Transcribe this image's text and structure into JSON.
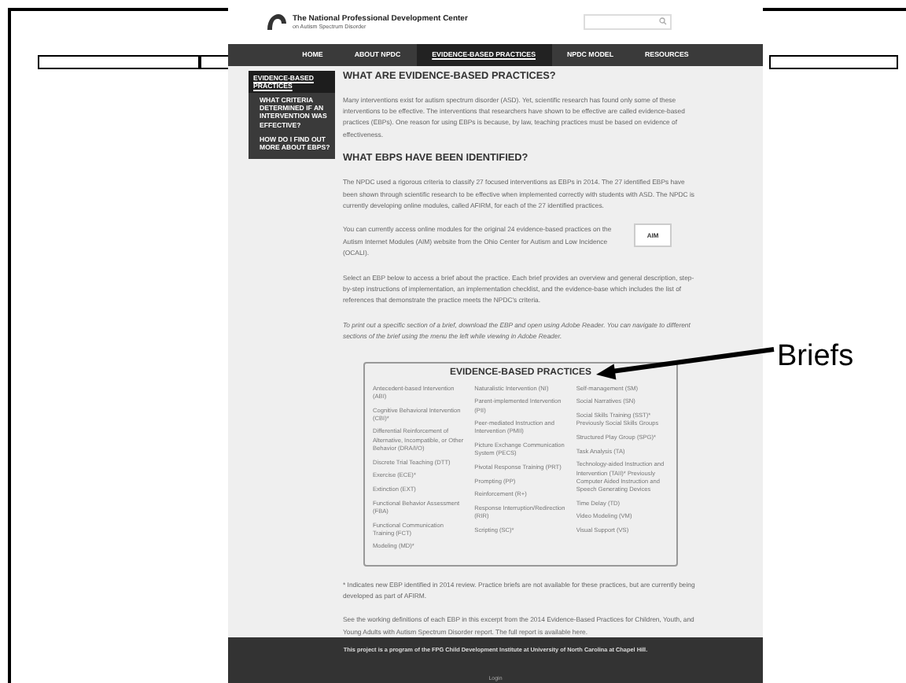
{
  "annotation": {
    "label": "Briefs"
  },
  "site": {
    "title": "The National Professional Development Center",
    "subtitle": "on Autism Spectrum Disorder"
  },
  "nav": [
    {
      "label": "HOME",
      "selected": false
    },
    {
      "label": "ABOUT NPDC",
      "selected": false
    },
    {
      "label": "EVIDENCE-BASED PRACTICES",
      "selected": true
    },
    {
      "label": "NPDC MODEL",
      "selected": false
    },
    {
      "label": "RESOURCES",
      "selected": false
    }
  ],
  "sidebar": [
    {
      "label": "EVIDENCE-BASED PRACTICES",
      "selected": true
    },
    {
      "label": "WHAT CRITERIA DETERMINED IF AN INTERVENTION WAS EFFECTIVE?",
      "selected": false
    },
    {
      "label": "HOW DO I FIND OUT MORE ABOUT EBPS?",
      "selected": false
    }
  ],
  "content": [
    {
      "kind": "heading",
      "text": "WHAT ARE EVIDENCE-BASED PRACTICES?"
    },
    {
      "kind": "para",
      "text": "Many interventions exist for autism spectrum disorder (ASD). Yet, scientific research has found only some of these interventions to be effective. The interventions that researchers have shown to be effective are called evidence-based practices (EBPs). One reason for using EBPs is because, by law, teaching practices must be based on evidence of effectiveness."
    },
    {
      "kind": "heading",
      "text": "WHAT EBPS HAVE BEEN IDENTIFIED?"
    },
    {
      "kind": "para",
      "text": "The NPDC used a rigorous criteria to classify 27 focused interventions as EBPs in 2014. The 27 identified EBPs have been shown through scientific research to be effective when implemented correctly with students with ASD. The NPDC is currently developing online modules, called AFIRM, for each of the 27 identified practices."
    },
    {
      "kind": "logo-para",
      "text": "You can currently access online modules for the original 24 evidence-based practices on the Autism Internet Modules (AIM) website from the Ohio Center for Autism and Low Incidence (OCALI).",
      "logo": "AIM"
    },
    {
      "kind": "para",
      "text": "Select an EBP below to access a brief about the practice. Each brief provides an overview and general description, step-by-step instructions of implementation, an implementation checklist, and the evidence-base which includes the list of references that demonstrate the practice meets the NPDC's criteria."
    },
    {
      "kind": "italic",
      "text": "To print out a specific section of a brief, download the EBP and open using Adobe Reader. You can navigate to different sections of the brief using the menu the left while viewing in Adobe Reader."
    }
  ],
  "practices": {
    "title": "EVIDENCE-BASED PRACTICES",
    "columns": [
      [
        "Antecedent-based Intervention (ABI)",
        "Cognitive Behavioral Intervention (CBI)*",
        "Differential Reinforcement of Alternative, Incompatible, or Other Behavior (DRA/I/O)",
        "Discrete Trial Teaching (DTT)",
        "Exercise (ECE)*",
        "Extinction (EXT)",
        "Functional Behavior Assessment (FBA)",
        "Functional Communication Training (FCT)",
        "Modeling (MD)*"
      ],
      [
        "Naturalistic Intervention (NI)",
        "Parent-implemented Intervention (PII)",
        "Peer-mediated Instruction and Intervention (PMII)",
        "Picture Exchange Communication System (PECS)",
        "Pivotal Response Training (PRT)",
        "Prompting (PP)",
        "Reinforcement (R+)",
        "Response Interruption/Redirection (RIR)",
        "Scripting (SC)*"
      ],
      [
        "Self-management (SM)",
        "Social Narratives (SN)",
        "Social Skills Training (SST)* Previously Social Skills Groups",
        "Structured Play Group (SPG)*",
        "Task Analysis (TA)",
        "Technology-aided Instruction and Intervention (TAII)* Previously Computer Aided Instruction and Speech Generating Devices",
        "Time Delay (TD)",
        "Video Modeling (VM)",
        "Visual Support (VS)"
      ]
    ]
  },
  "notes": [
    "* Indicates new EBP identified in 2014 review. Practice briefs are not available for these practices, but are currently being developed as part of AFIRM.",
    "See the working definitions of each EBP in this excerpt from the 2014 Evidence-Based Practices for Children, Youth, and Young Adults with Autism Spectrum Disorder report. The full report is available here."
  ],
  "footer": {
    "text": "This project is a program of the FPG Child Development Institute at University of North Carolina at Chapel Hill.",
    "login": "Login"
  }
}
